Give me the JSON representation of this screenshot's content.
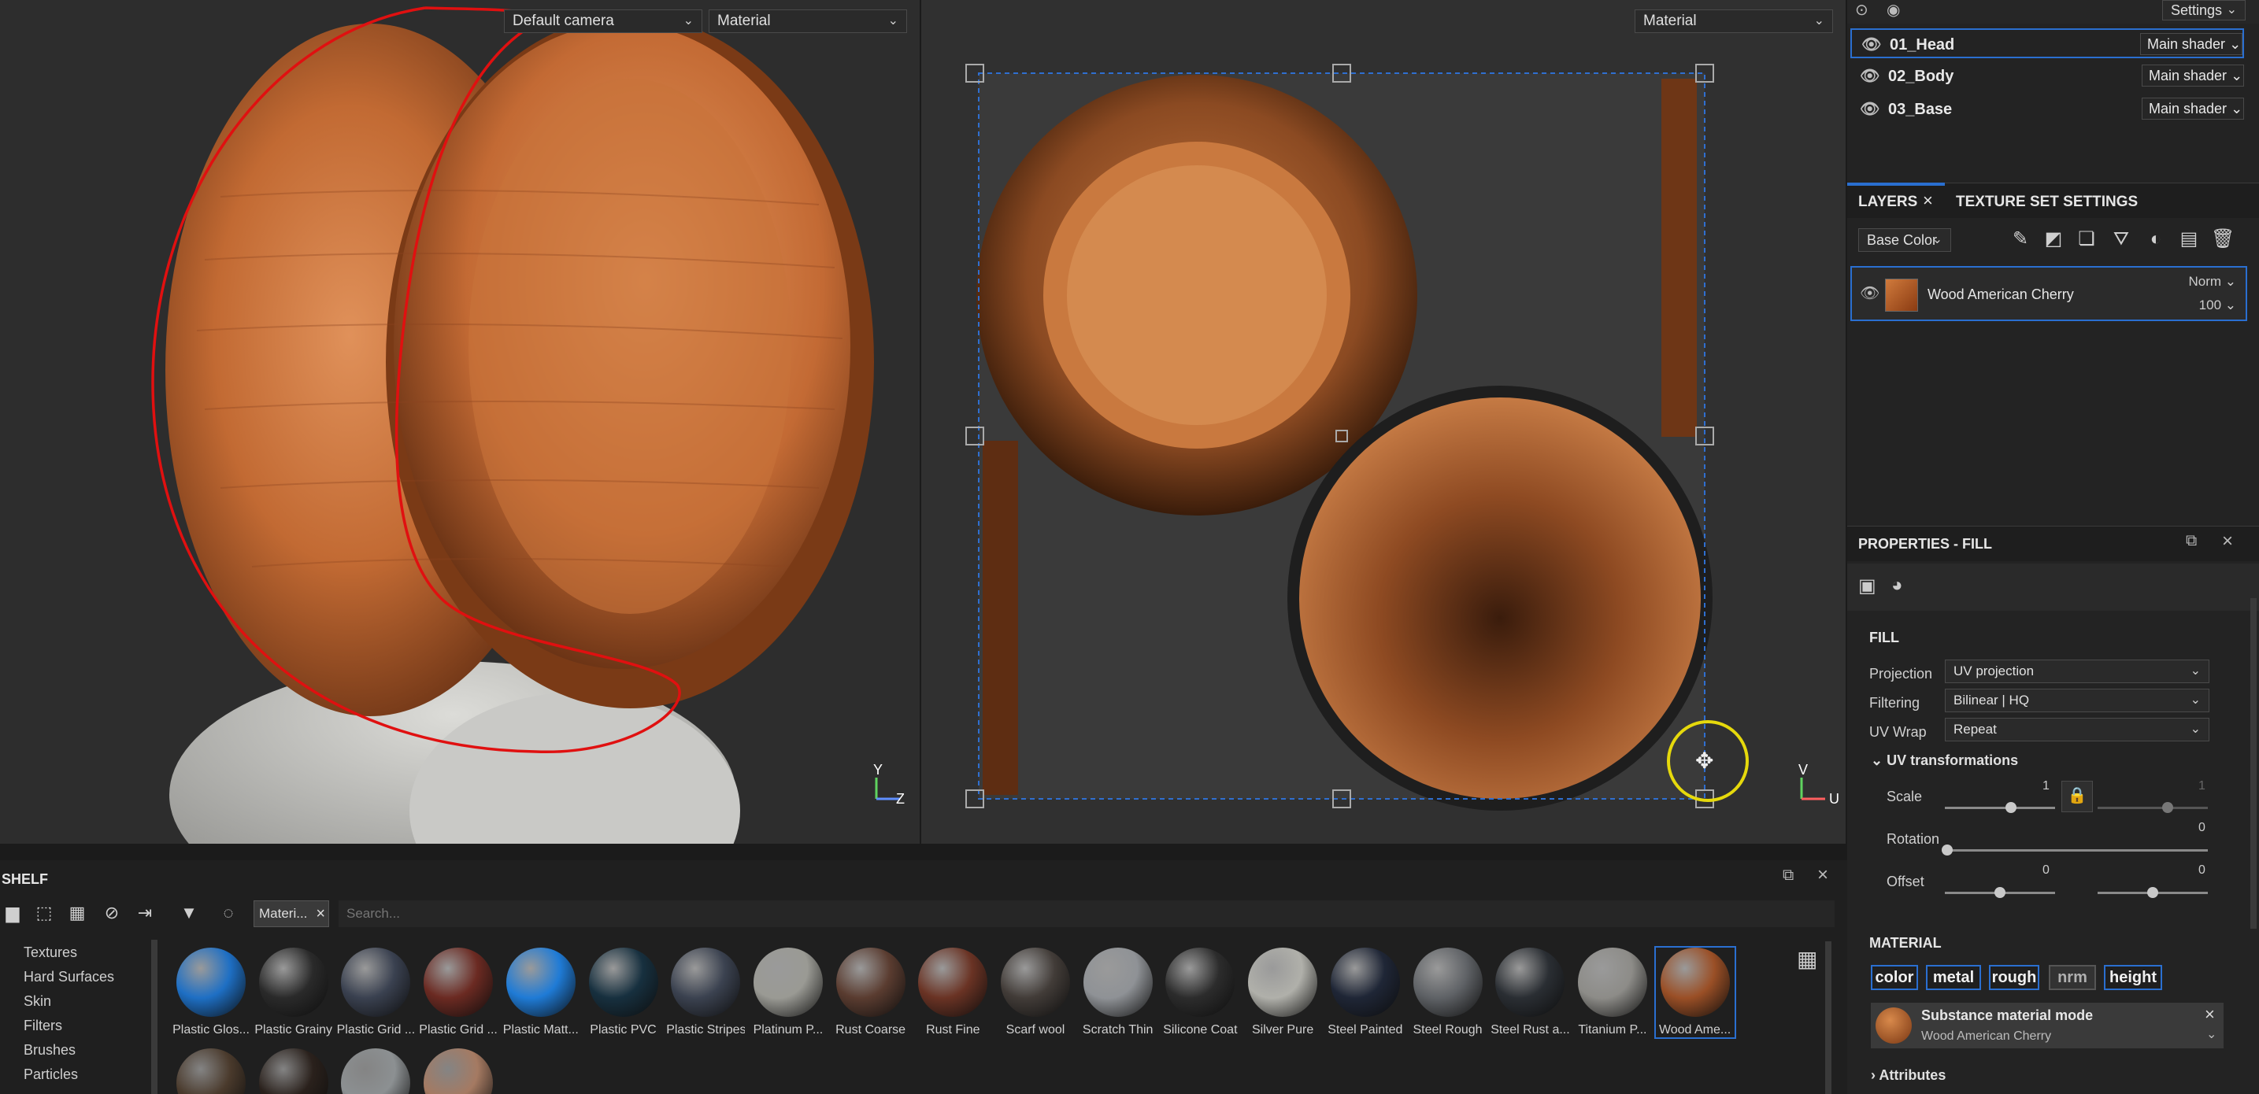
{
  "viewport3d": {
    "camera": "Default camera",
    "channel": "Material",
    "axis_y": "Y",
    "axis_z": "Z"
  },
  "viewport2d": {
    "channel": "Material",
    "axis_v": "V",
    "axis_u": "U"
  },
  "texture_sets": {
    "settings_label": "Settings",
    "items": [
      {
        "name": "01_Head",
        "shader": "Main shader"
      },
      {
        "name": "02_Body",
        "shader": "Main shader"
      },
      {
        "name": "03_Base",
        "shader": "Main shader"
      }
    ]
  },
  "layers_panel": {
    "tab_layers": "LAYERS",
    "tab_texture_set": "TEXTURE SET SETTINGS",
    "channel_select": "Base Color",
    "layer": {
      "name": "Wood American Cherry",
      "blend": "Norm",
      "opacity": "100"
    }
  },
  "properties": {
    "title": "PROPERTIES - FILL",
    "fill_header": "FILL",
    "projection_label": "Projection",
    "projection_value": "UV projection",
    "filtering_label": "Filtering",
    "filtering_value": "Bilinear | HQ",
    "uvwrap_label": "UV Wrap",
    "uvwrap_value": "Repeat",
    "uv_transform_label": "UV transformations",
    "scale_label": "Scale",
    "scale_value": "1",
    "scale_value_right": "1",
    "rotation_label": "Rotation",
    "rotation_value": "0",
    "offset_label": "Offset",
    "offset_value_left": "0",
    "offset_value_right": "0",
    "material_header": "MATERIAL",
    "channels": [
      "color",
      "metal",
      "rough",
      "nrm",
      "height"
    ],
    "material_mode_title": "Substance material mode",
    "material_mode_value": "Wood American Cherry",
    "attributes_label": "Attributes"
  },
  "shelf": {
    "title": "SHELF",
    "filter_tag": "Materi...",
    "search_placeholder": "Search...",
    "categories": [
      "Textures",
      "Hard Surfaces",
      "Skin",
      "Filters",
      "Brushes",
      "Particles"
    ],
    "materials": [
      {
        "label": "Plastic Glos...",
        "color": "#1e6fc4"
      },
      {
        "label": "Plastic Grainy",
        "color": "#2a2a2a"
      },
      {
        "label": "Plastic Grid ...",
        "color": "#3a4150"
      },
      {
        "label": "Plastic Grid ...",
        "color": "#6b2a22"
      },
      {
        "label": "Plastic Matt...",
        "color": "#1f7bd6"
      },
      {
        "label": "Plastic PVC",
        "color": "#17303f"
      },
      {
        "label": "Plastic Stripes",
        "color": "#3b4250"
      },
      {
        "label": "Platinum P...",
        "color": "#9a9a94"
      },
      {
        "label": "Rust Coarse",
        "color": "#5a3c30"
      },
      {
        "label": "Rust Fine",
        "color": "#6a3324"
      },
      {
        "label": "Scarf wool",
        "color": "#423c38"
      },
      {
        "label": "Scratch Thin",
        "color": "#8f9296"
      },
      {
        "label": "Silicone Coat",
        "color": "#2c2c2c"
      },
      {
        "label": "Silver Pure",
        "color": "#b0b0aa"
      },
      {
        "label": "Steel Painted",
        "color": "#1f2636"
      },
      {
        "label": "Steel Rough",
        "color": "#5f6266"
      },
      {
        "label": "Steel Rust a...",
        "color": "#2a2e33"
      },
      {
        "label": "Titanium P...",
        "color": "#8d8c88"
      },
      {
        "label": "Wood Ame...",
        "color": "#9a4f26"
      }
    ],
    "row2_colors": [
      "#4a3a2c",
      "#2a211c",
      "#8c9092",
      "#a57a62"
    ]
  }
}
